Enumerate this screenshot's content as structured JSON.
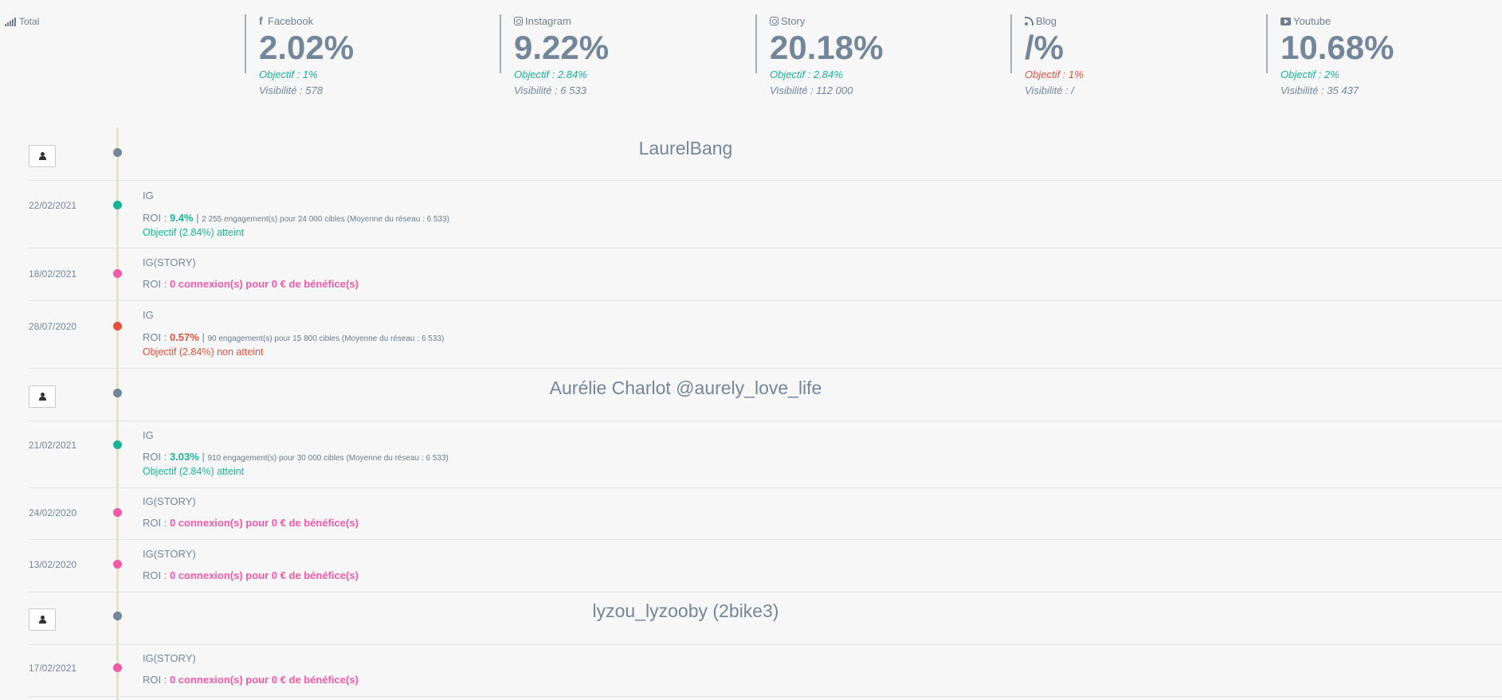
{
  "total": {
    "label": "Total",
    "icon": "signal-bars-icon"
  },
  "stats": [
    {
      "network": "Facebook",
      "icon": "facebook-icon",
      "value": "2.02%",
      "objective": "Objectif : 1%",
      "objective_status": "met",
      "visibility": "Visibilité : 578"
    },
    {
      "network": "Instagram",
      "icon": "instagram-icon",
      "value": "9.22%",
      "objective": "Objectif : 2.84%",
      "objective_status": "met",
      "visibility": "Visibilité : 6 533"
    },
    {
      "network": "Story",
      "icon": "instagram-icon",
      "value": "20.18%",
      "objective": "Objectif : 2.84%",
      "objective_status": "met",
      "visibility": "Visibilité : 112 000"
    },
    {
      "network": "Blog",
      "icon": "rss-icon",
      "value": "/%",
      "objective": "Objectif : 1%",
      "objective_status": "not-met",
      "visibility": "Visibilité : /"
    },
    {
      "network": "Youtube",
      "icon": "youtube-icon",
      "value": "10.68%",
      "objective": "Objectif : 2%",
      "objective_status": "met",
      "visibility": "Visibilité : 35 437"
    }
  ],
  "timeline": {
    "influencers": [
      {
        "name": "LaurelBang",
        "button_icon": "user-icon",
        "events": [
          {
            "date": "22/02/2021",
            "type": "IG",
            "status": "success",
            "roi_prefix": "ROI : ",
            "roi_value": "9.4%",
            "roi_sep": " | ",
            "roi_detail": "2 255 engagement(s) pour 24 000 cibles (Moyenne du réseau : 6 533)",
            "objective": "Objectif (2.84%) atteint"
          },
          {
            "date": "18/02/2021",
            "type": "IG(STORY)",
            "status": "story",
            "roi_prefix": "ROI : ",
            "roi_value": "0 connexion(s) pour 0 € de bénéfice(s)"
          },
          {
            "date": "28/07/2020",
            "type": "IG",
            "status": "failure",
            "roi_prefix": "ROI : ",
            "roi_value": "0.57%",
            "roi_sep": " | ",
            "roi_detail": "90 engagement(s) pour 15 800 cibles (Moyenne du réseau : 6 533)",
            "objective": "Objectif (2.84%) non atteint"
          }
        ]
      },
      {
        "name": "Aurélie Charlot @aurely_love_life",
        "button_icon": "user-icon",
        "events": [
          {
            "date": "21/02/2021",
            "type": "IG",
            "status": "success",
            "roi_prefix": "ROI : ",
            "roi_value": "3.03%",
            "roi_sep": " | ",
            "roi_detail": "910 engagement(s) pour 30 000 cibles (Moyenne du réseau : 6 533)",
            "objective": "Objectif (2.84%) atteint"
          },
          {
            "date": "24/02/2020",
            "type": "IG(STORY)",
            "status": "story",
            "roi_prefix": "ROI : ",
            "roi_value": "0 connexion(s) pour 0 € de bénéfice(s)"
          },
          {
            "date": "13/02/2020",
            "type": "IG(STORY)",
            "status": "story",
            "roi_prefix": "ROI : ",
            "roi_value": "0 connexion(s) pour 0 € de bénéfice(s)"
          }
        ]
      },
      {
        "name": "lyzou_lyzooby (2bike3)",
        "button_icon": "user-icon",
        "events": [
          {
            "date": "17/02/2021",
            "type": "IG(STORY)",
            "status": "story",
            "roi_prefix": "ROI : ",
            "roi_value": "0 connexion(s) pour 0 € de bénéfice(s)"
          }
        ]
      }
    ]
  },
  "colors": {
    "success": "#1bb396",
    "failure": "#e2503b",
    "story": "#f05aa6",
    "neutral": "#74869a"
  }
}
